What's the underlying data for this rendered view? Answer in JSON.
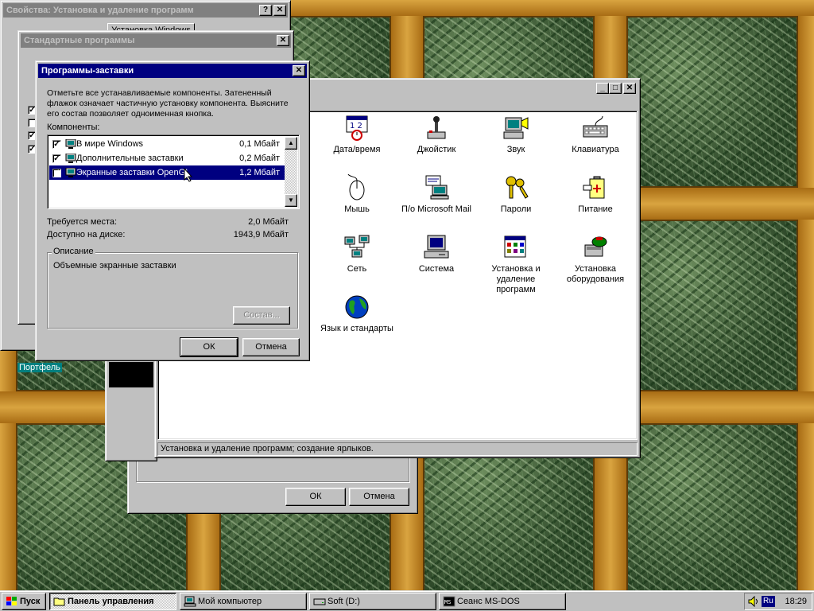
{
  "desktop": {
    "portfolio_label": "Портфель"
  },
  "add_remove_window": {
    "title": "Свойства: Установка и удаление программ",
    "tab_partial": "Установка Windows",
    "ok": "ОК",
    "cancel": "Отмена"
  },
  "standard_programs_window": {
    "title": "Стандартные программы"
  },
  "screensavers_dialog": {
    "title": "Программы-заставки",
    "instructions": "Отметьте все устанавливаемые компоненты. Затененный флажок означает частичную установку компонента. Выясните его состав позволяет одноименная кнопка.",
    "components_label": "Компоненты:",
    "components": [
      {
        "checked": "✓",
        "name": "В мире Windows",
        "size": "0,1 Мбайт"
      },
      {
        "checked": "✓",
        "name": "Дополнительные заставки",
        "size": "0,2 Мбайт"
      },
      {
        "checked": "✓",
        "name": "Экранные заставки OpenGL",
        "size": "1,2 Мбайт"
      }
    ],
    "space_required_label": "Требуется места:",
    "space_required_value": "2,0 Мбайт",
    "space_available_label": "Доступно на диске:",
    "space_available_value": "1943,9 Мбайт",
    "description_label": "Описание",
    "description_text": "Объемные экранные заставки",
    "details_button": "Состав...",
    "ok": "ОК",
    "cancel": "Отмена"
  },
  "control_panel": {
    "items": [
      {
        "label": "Дата/время",
        "icon": "datetime-icon"
      },
      {
        "label": "Джойстик",
        "icon": "joystick-icon"
      },
      {
        "label": "Звук",
        "icon": "sound-icon"
      },
      {
        "label": "Клавиатура",
        "icon": "keyboard-icon"
      },
      {
        "label": "Мышь",
        "icon": "mouse-icon"
      },
      {
        "label": "П/о Microsoft Mail",
        "icon": "mail-icon"
      },
      {
        "label": "Пароли",
        "icon": "keys-icon"
      },
      {
        "label": "Питание",
        "icon": "power-icon"
      },
      {
        "label": "Сеть",
        "icon": "network-icon"
      },
      {
        "label": "Система",
        "icon": "system-icon"
      },
      {
        "label": "Установка и удаление программ",
        "icon": "add-remove-icon"
      },
      {
        "label": "Установка оборудования",
        "icon": "add-hardware-icon"
      },
      {
        "label": "Язык и стандарты",
        "icon": "globe-icon"
      }
    ],
    "status": "Установка и удаление программ; создание ярлыков."
  },
  "background_dialog": {
    "ok": "ОК",
    "cancel": "Отмена"
  },
  "taskbar": {
    "start": "Пуск",
    "tasks": [
      {
        "label": "Панель управления",
        "pressed": true
      },
      {
        "label": "Мой компьютер",
        "pressed": false
      },
      {
        "label": "Soft (D:)",
        "pressed": false
      },
      {
        "label": "Сеанс MS-DOS",
        "pressed": false
      }
    ],
    "lang": "Ru",
    "clock": "18:29"
  },
  "colors": {
    "title_active": "#000080",
    "title_inactive": "#808080",
    "face": "#c0c0c0"
  }
}
